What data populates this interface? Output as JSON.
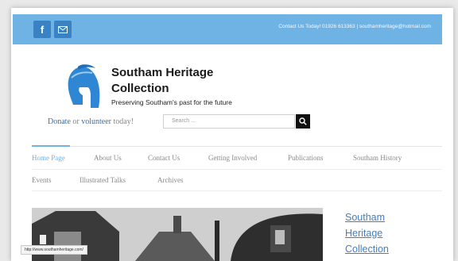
{
  "topbar": {
    "facebook_glyph": "f",
    "contact_text": "Contact Us Today! 01926 613363  |  southamheritage@hotmail.com"
  },
  "logo": {
    "title_line1": "Southam Heritage",
    "title_line2": "Collection",
    "tagline": "Preserving Southam's past for the future"
  },
  "donate_row": {
    "donate": "Donate",
    "or": "or",
    "volunteer": "volunteer",
    "today": "today!"
  },
  "search": {
    "placeholder": "Search ..."
  },
  "nav": {
    "row1": [
      "Home Page",
      "About Us",
      "Contact Us",
      "Getting Involved",
      "Publications",
      "Southam History"
    ],
    "row2": [
      "Events",
      "Illustrated Talks",
      "Archives"
    ],
    "active": "Home Page"
  },
  "status_bar": {
    "url": "http://www.southamheritage.com/"
  },
  "sidebar": {
    "heading_line1": "Southam",
    "heading_line2": "Heritage",
    "heading_line3": "Collection"
  },
  "colors": {
    "topbar": "#6fb3e4",
    "social_button": "#3b82c4",
    "link_blue": "#3b6db1",
    "nav_active": "#6fb3e4"
  },
  "icons": {
    "facebook": "facebook-icon",
    "mail": "mail-icon",
    "search": "search-icon",
    "logo": "spartan-helmet-logo"
  }
}
